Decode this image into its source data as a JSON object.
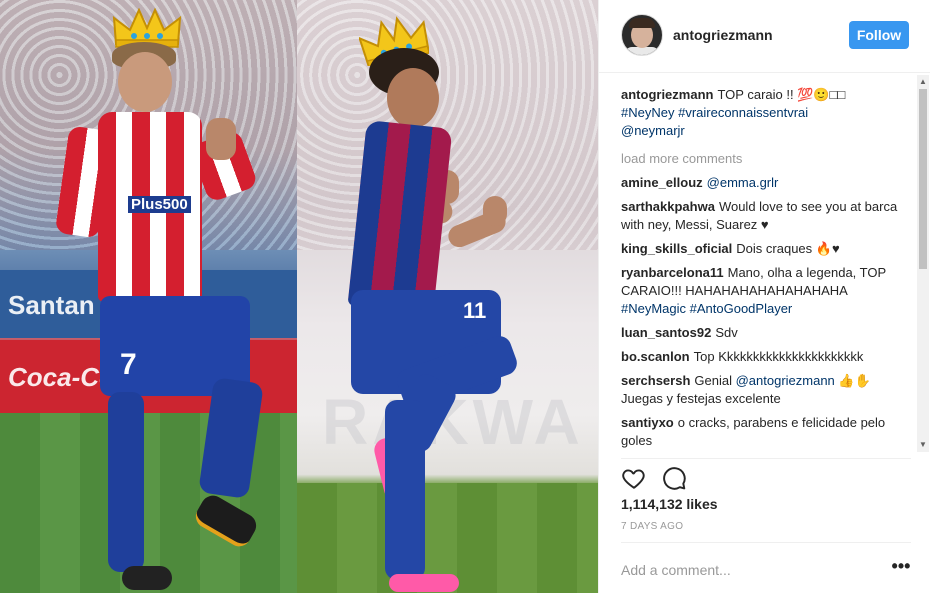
{
  "post": {
    "username": "antogriezmann",
    "follow_label": "Follow",
    "caption": {
      "user": "antogriezmann",
      "text": "TOP caraio !! 💯🙂□□",
      "tags": [
        "#NeyNey",
        "#vraireconnaissentvrai",
        "@neymarjr"
      ]
    },
    "load_more": "load more comments",
    "comments": [
      {
        "user": "amine_ellouz",
        "text": "",
        "mention": "@emma.grlr",
        "tail": ""
      },
      {
        "user": "sarthakkpahwa",
        "text": "Would love to see you at barca with ney, Messi, Suarez ♥",
        "mention": "",
        "tail": ""
      },
      {
        "user": "king_skills_oficial",
        "text": "Dois craques 🔥♥",
        "mention": "",
        "tail": ""
      },
      {
        "user": "ryanbarcelona11",
        "text": "Mano, olha a legenda, TOP CARAIO!!! HAHAHAHAHAHAHAHAHA",
        "mention": "#NeyMagic #AntoGoodPlayer",
        "tail": ""
      },
      {
        "user": "luan_santos92",
        "text": "Sdv",
        "mention": "",
        "tail": ""
      },
      {
        "user": "bo.scanlon",
        "text": "Top Kkkkkkkkkkkkkkkkkkkkkk",
        "mention": "",
        "tail": ""
      },
      {
        "user": "serchsersh",
        "text": "Genial",
        "mention": "@antogriezmann",
        "tail": "👍✋ Juegas y festejas excelente"
      },
      {
        "user": "santiyxo",
        "text": "o cracks, parabens e felicidade pelo goles",
        "mention": "",
        "tail": ""
      }
    ],
    "likes": "1,114,132 likes",
    "time": "7 DAYS AGO",
    "add_comment_placeholder": "Add a comment...",
    "more_label": "•••",
    "photo_text": {
      "sponsor": "Plus500",
      "board1": "Santan",
      "board2": "Coca-Cola",
      "wall": "RAKWA",
      "number_left": "7",
      "number_right": "11"
    }
  },
  "colors": {
    "follow_bg": "#3897f0",
    "link": "#003569",
    "muted": "#999999"
  },
  "icons": {
    "like": "heart-icon",
    "comment": "speech-bubble-icon",
    "more": "ellipsis-icon"
  }
}
